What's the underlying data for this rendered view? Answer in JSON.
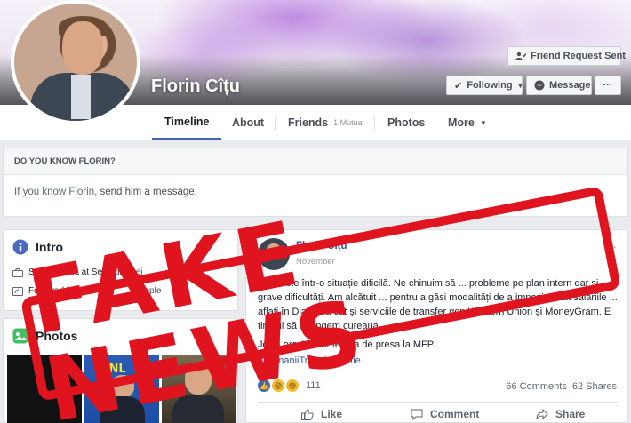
{
  "profile": {
    "name": "Florin Cîțu",
    "buttons": {
      "friend_request": "Friend Request Sent",
      "following": "Following",
      "message": "Message",
      "more": "···"
    }
  },
  "nav": {
    "tabs": [
      {
        "label": "Timeline"
      },
      {
        "label": "About"
      },
      {
        "label": "Friends",
        "sub": "1 Mutual"
      },
      {
        "label": "Photos"
      },
      {
        "label": "More"
      }
    ]
  },
  "know_panel": {
    "title": "DO YOU KNOW FLORIN?",
    "text_prefix": "If you know Florin, ",
    "link": "send him a message."
  },
  "intro": {
    "title": "Intro",
    "rows": [
      {
        "text": "Senator PNL at Senatul R",
        "tail": "ei"
      },
      {
        "text": "Followed by",
        "tail": "people"
      }
    ]
  },
  "photos": {
    "title": "Photos"
  },
  "post": {
    "author": "Florin Cîțu",
    "date": "November",
    "body": "Țara este într-o situație dificilă. Ne chinuim să ... probleme pe plan intern dar și ... grave dificultăți. Am alcătuit ... pentru a găsi modalități de a impozita atât salariile ... aflați în Diaspora cât și serviciile de transfer gen Western Union și MoneyGram. E timpul să strângem cureaua...",
    "line2": "Joi la ora 10, conferinta de presa la MFP.",
    "hashtag": "#RomaniiTrebuieSaStie",
    "reactions_count": "111",
    "comments": "66 Comments",
    "shares": "62 Shares",
    "actions": {
      "like": "Like",
      "comment": "Comment",
      "share": "Share"
    }
  },
  "stamp": {
    "text": "FAKE NEWS",
    "color": "#e0141f"
  },
  "colors": {
    "fb_blue": "#4267b2",
    "link": "#365899",
    "bg": "#e9ebee"
  }
}
